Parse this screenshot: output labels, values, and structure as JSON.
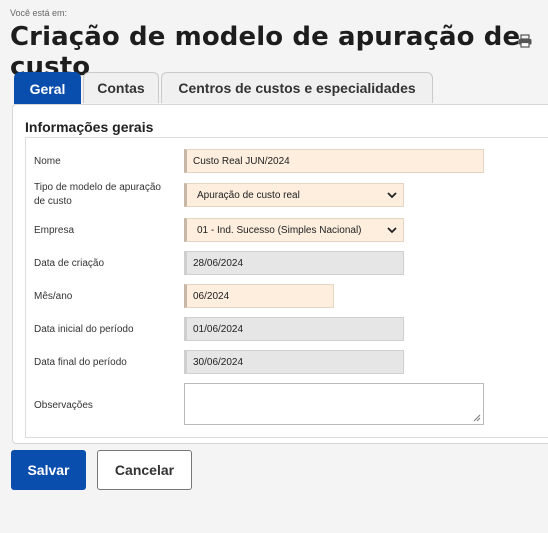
{
  "breadcrumb": "Você está em:",
  "page_title": "Criação de modelo de apuração de custo",
  "icons": {
    "print": "print-icon",
    "select_arrow": "chevron-down-icon"
  },
  "tabs": [
    {
      "label": "Geral",
      "active": true
    },
    {
      "label": "Contas",
      "active": false
    },
    {
      "label": "Centros de custos e especialidades",
      "active": false
    }
  ],
  "section_title": "Informações gerais",
  "fields": {
    "nome": {
      "label": "Nome",
      "value": "Custo Real JUN/2024"
    },
    "tipo": {
      "label": "Tipo de modelo de apuração de custo",
      "value": "Apuração de custo real"
    },
    "empresa": {
      "label": "Empresa",
      "value": "01 - Ind. Sucesso (Simples Nacional)"
    },
    "data_criacao": {
      "label": "Data de criação",
      "value": "28/06/2024"
    },
    "mes_ano": {
      "label": "Mês/ano",
      "value": "06/2024"
    },
    "data_inicial": {
      "label": "Data inicial do período",
      "value": "01/06/2024"
    },
    "data_final": {
      "label": "Data final do período",
      "value": "30/06/2024"
    },
    "observacoes": {
      "label": "Observações",
      "value": ""
    }
  },
  "buttons": {
    "save": "Salvar",
    "cancel": "Cancelar"
  },
  "colors": {
    "primary": "#0a4ead",
    "required_field_bg": "#fdeede",
    "readonly_field_bg": "#e6e6e6"
  }
}
